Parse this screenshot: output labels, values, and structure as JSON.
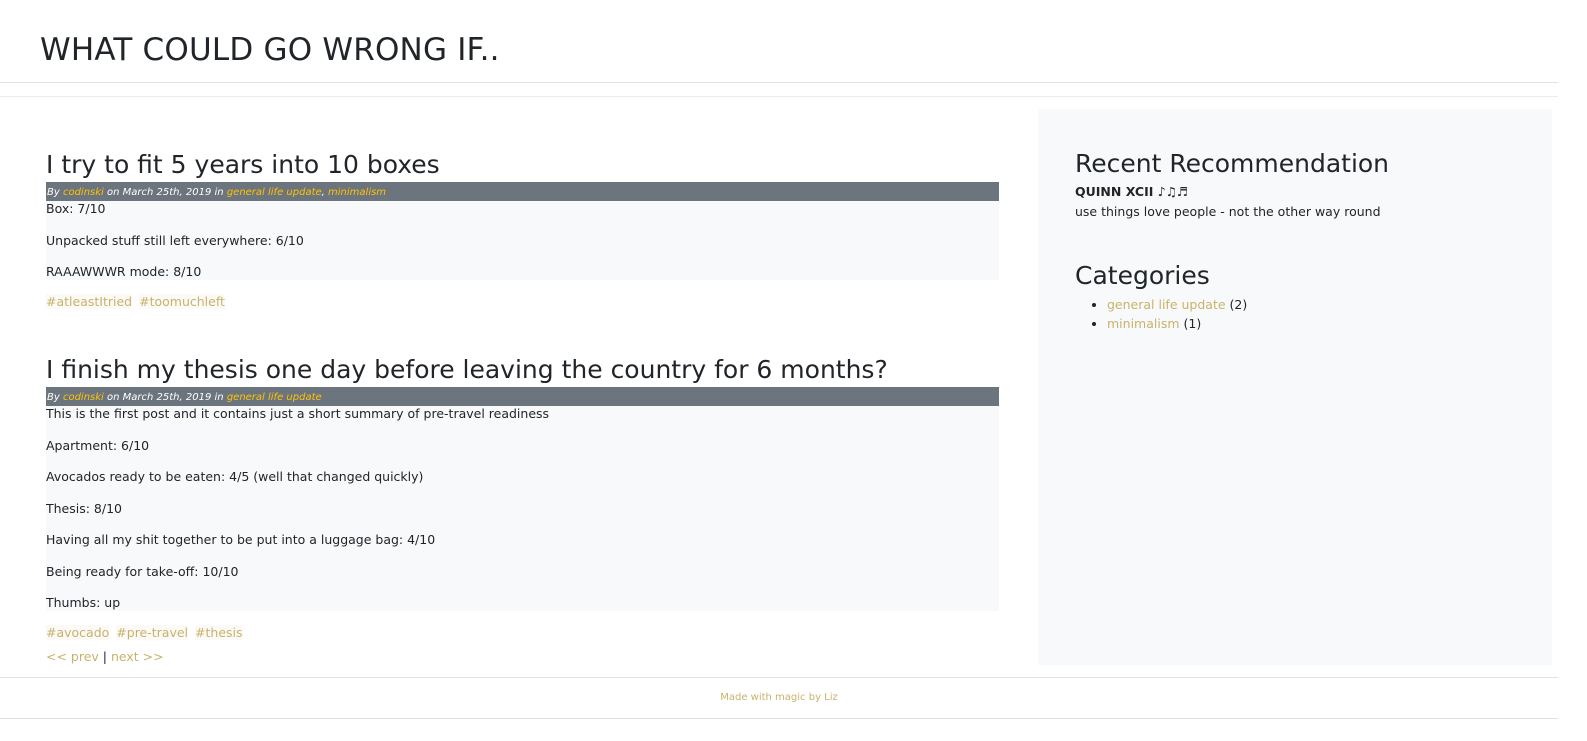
{
  "site": {
    "title": "WHAT COULD GO WRONG IF.."
  },
  "posts": [
    {
      "title": "I try to fit 5 years into 10 boxes",
      "meta": {
        "by": "By",
        "author": "codinski",
        "on": "on March 25th, 2019 in",
        "categories": [
          "general life update",
          "minimalism"
        ],
        "sep": ","
      },
      "body": [
        "Box: 7/10",
        "Unpacked stuff still left everywhere: 6/10",
        "RAAAWWWR mode: 8/10"
      ],
      "tags": [
        "#atleastItried",
        "#toomuchleft"
      ]
    },
    {
      "title": "I finish my thesis one day before leaving the country for 6 months?",
      "meta": {
        "by": "By",
        "author": "codinski",
        "on": "on March 25th, 2019 in",
        "categories": [
          "general life update"
        ]
      },
      "body": [
        "This is the first post and it contains just a short summary of pre-travel readiness",
        "Apartment: 6/10",
        "Avocados ready to be eaten: 4/5 (well that changed quickly)",
        "Thesis: 8/10",
        "Having all my shit together to be put into a luggage bag: 4/10",
        "Being ready for take-off: 10/10",
        "Thumbs: up"
      ],
      "tags": [
        "#avocado",
        "#pre-travel",
        "#thesis"
      ]
    }
  ],
  "pager": {
    "prev": "<< prev",
    "sep": "|",
    "next": "next >>"
  },
  "sidebar": {
    "recommendation": {
      "heading": "Recent Recommendation",
      "artist": "QUINN XCII ♪♫♬",
      "text": "use things love people - not the other way round"
    },
    "categories": {
      "heading": "Categories",
      "items": [
        {
          "label": "general life update",
          "count": "(2)"
        },
        {
          "label": "minimalism",
          "count": "(1)"
        }
      ]
    }
  },
  "footer": {
    "text": "Made with magic by Liz"
  },
  "colors": {
    "accent": "#c9b26b",
    "meta_bg": "#6c757d",
    "meta_link": "#ffc107",
    "panel_bg": "#f8f9fa"
  }
}
